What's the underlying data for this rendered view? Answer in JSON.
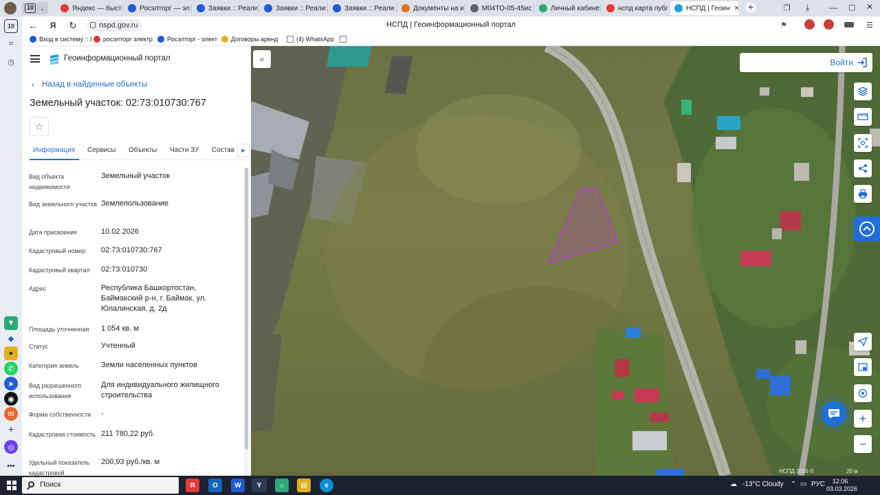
{
  "browser": {
    "tab_count": "10",
    "tabs": [
      {
        "label": "Яндекс — быстр",
        "color": "#e53935"
      },
      {
        "label": "Росэлторг — эле",
        "color": "#1e5bd6"
      },
      {
        "label": "Заявки :: Реализ",
        "color": "#1e5bd6"
      },
      {
        "label": "Заявки :: Реализ",
        "color": "#1e5bd6"
      },
      {
        "label": "Заявки :: Реализ",
        "color": "#1e5bd6"
      },
      {
        "label": "Документы на и:",
        "color": "#e0701a"
      },
      {
        "label": "М04ТО-05-45иск",
        "color": "#5a6270"
      },
      {
        "label": "Личный кабинет",
        "color": "#2aa876"
      },
      {
        "label": "нспд карта публ",
        "color": "#e53935"
      },
      {
        "label": "НСПД | Геоин",
        "color": "#1ea0d6"
      }
    ],
    "url": "nspd.gov.ru",
    "page_title": "НСПД | Геоинформационный портал",
    "bookmarks": [
      "Вход в систему :: I",
      "росэлторг электр",
      "Росэлторг - элект",
      "Договоры аренд",
      "(4) WhatsApp"
    ],
    "vertical_badge": "10"
  },
  "portal": {
    "name": "Геоинформационный портал",
    "back_link": "Назад в найденные объекты",
    "object_title": "Земельный участок: 02:73:010730:767",
    "tabs": [
      "Информация",
      "Сервисы",
      "Объекты",
      "Части ЗУ",
      "Состав"
    ],
    "active_tab": "Информация",
    "rows": [
      {
        "label": "Вид объекта недвижимости",
        "value": "Земельный участок"
      },
      {
        "label": "Вид земельного участка",
        "value": "Землепользование"
      },
      {
        "label": "Дата присвоения",
        "value": "10.02.2026"
      },
      {
        "label": "Кадастровый номер",
        "value": "02:73:010730:767"
      },
      {
        "label": "Кадастровый квартал",
        "value": "02:73:010730"
      },
      {
        "label": "Адрес",
        "value": "Республика Башкортостан, Баймакский р-н, г. Баймак, ул. Юлалинская, д. 2д"
      },
      {
        "label": "Площадь уточненная",
        "value": "1 054 кв. м"
      },
      {
        "label": "Статус",
        "value": "Учтенный"
      },
      {
        "label": "Категория земель",
        "value": "Земли населенных пунктов"
      },
      {
        "label": "Вид разрешенного использования",
        "value": "Для индивидуального жилищного строительства"
      },
      {
        "label": "Форма собственности",
        "value": "-"
      },
      {
        "label": "Кадастровая стоимость",
        "value": "211 780,22 руб."
      },
      {
        "label": "Удельный показатель кадастровой",
        "value": "200,93 руб./кв. м"
      }
    ]
  },
  "map": {
    "login_label": "Войти",
    "copyright": "НСПД 2026 ©",
    "scale": "20 м",
    "parcel_color": "#b43cc8"
  },
  "taskbar": {
    "search_label": "Поиск",
    "weather": "-13°C Cloudy",
    "lang": "РУС",
    "time": "12:06",
    "date": "03.03.2026"
  }
}
